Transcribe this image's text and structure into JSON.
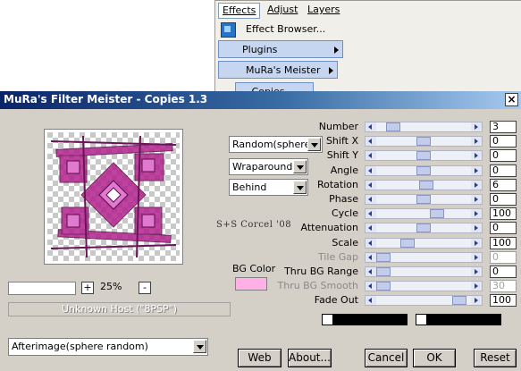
{
  "menu": {
    "items": [
      "Effects",
      "Adjust",
      "Layers"
    ],
    "effect_browser": "Effect Browser...",
    "plugins": "Plugins",
    "mura": "MuRa's Meister",
    "copies": "Copies ..."
  },
  "dialog": {
    "title": "MuRa's Filter Meister - Copies 1.3",
    "close": "×",
    "zoom": "25%",
    "plus": "+",
    "minus": "-",
    "host": "Unknown Host (\"8PSP\")",
    "selects": {
      "mode": "Random(sphere)",
      "edge": "Wraparound",
      "order": "Behind",
      "preset": "Afterimage(sphere random)"
    },
    "signature": "S+S Corcel '08",
    "bgcolor_label": "BG Color",
    "bgcolor": "#ffb0e6",
    "params": [
      {
        "label": "Number",
        "value": "3",
        "pos": 0.12,
        "enabled": true
      },
      {
        "label": "Shift X",
        "value": "0",
        "pos": 0.5,
        "enabled": true
      },
      {
        "label": "Shift Y",
        "value": "0",
        "pos": 0.5,
        "enabled": true
      },
      {
        "label": "Angle",
        "value": "0",
        "pos": 0.5,
        "enabled": true
      },
      {
        "label": "Rotation",
        "value": "6",
        "pos": 0.53,
        "enabled": true
      },
      {
        "label": "Phase",
        "value": "0",
        "pos": 0.5,
        "enabled": true
      },
      {
        "label": "Cycle",
        "value": "100",
        "pos": 0.67,
        "enabled": true
      },
      {
        "label": "Attenuation",
        "value": "0",
        "pos": 0.5,
        "enabled": true
      },
      {
        "label": "Scale",
        "value": "100",
        "pos": 0.3,
        "enabled": true
      },
      {
        "label": "Tile Gap",
        "value": "0",
        "pos": 0.0,
        "enabled": false
      },
      {
        "label": "Thru BG Range",
        "value": "0",
        "pos": 0.0,
        "enabled": true
      },
      {
        "label": "Thru BG Smooth",
        "value": "30",
        "pos": 0.0,
        "enabled": false
      },
      {
        "label": "Fade Out",
        "value": "100",
        "pos": 0.94,
        "enabled": true
      }
    ],
    "buttons": {
      "web": "Web",
      "about": "About...",
      "cancel": "Cancel",
      "ok": "OK",
      "reset": "Reset"
    }
  },
  "colors": {
    "accent": "#0a246a",
    "preview_magenta": "#b3238f",
    "menu_highlight": "#c6d6f0"
  }
}
